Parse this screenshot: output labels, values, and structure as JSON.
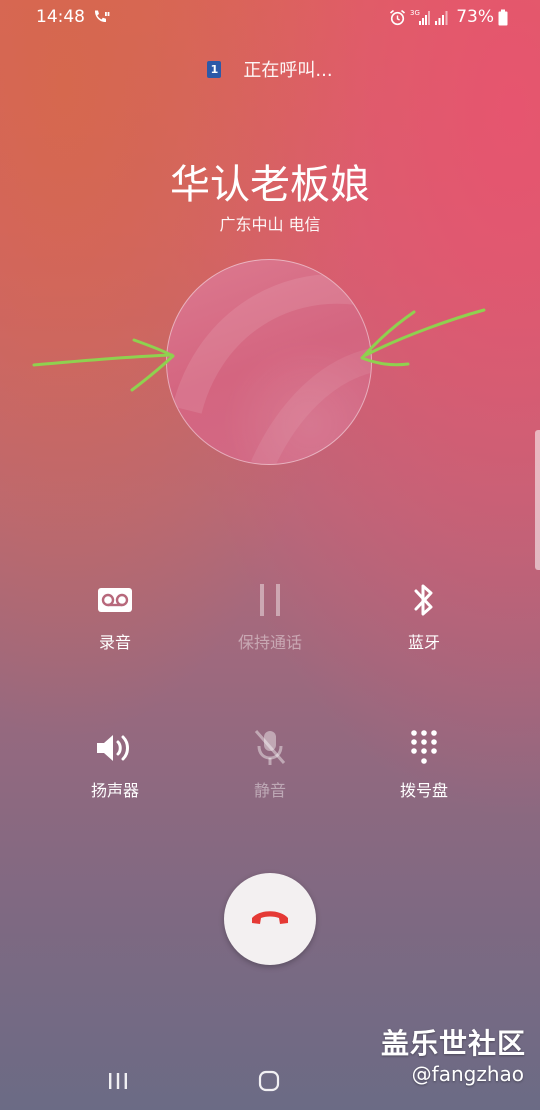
{
  "status_bar": {
    "time": "14:48",
    "battery_percent": "73%",
    "network_label": "3G"
  },
  "call": {
    "status_text": "正在呼叫...",
    "sim_slot": "1",
    "contact_name": "华认老板娘",
    "location": "广东中山 电信"
  },
  "controls": [
    {
      "label": "录音",
      "icon": "voicemail-record-icon",
      "enabled": true
    },
    {
      "label": "保持通话",
      "icon": "pause-icon",
      "enabled": false
    },
    {
      "label": "蓝牙",
      "icon": "bluetooth-icon",
      "enabled": true
    },
    {
      "label": "扬声器",
      "icon": "speaker-icon",
      "enabled": true
    },
    {
      "label": "静音",
      "icon": "mic-off-icon",
      "enabled": false
    },
    {
      "label": "拨号盘",
      "icon": "dialpad-icon",
      "enabled": true
    }
  ],
  "end_call": {
    "icon": "end-call-icon",
    "color": "#e53935"
  },
  "watermark": {
    "title": "盖乐世社区",
    "handle": "@fangzhao"
  },
  "annotation_color": "#8fd14f",
  "nav_bar": {
    "recents_icon": "recents-icon",
    "home_icon": "home-icon"
  }
}
